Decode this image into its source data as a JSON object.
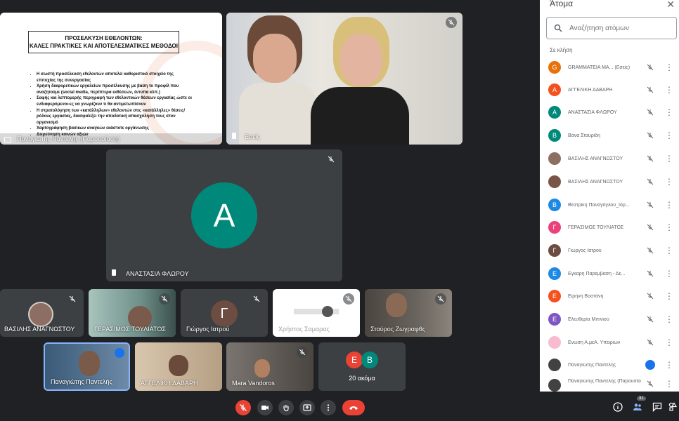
{
  "colors": {
    "teal": "#00897b",
    "red": "#ea4335",
    "brown": "#6d4c41"
  },
  "slide": {
    "title1": "ΠΡΟΣΕΛΚΥΣΗ ΕΘΕΛΟΝΤΩΝ:",
    "title2": "ΚΑΛΕΣ ΠΡΑΚΤΙΚΕΣ ΚΑΙ ΑΠΟΤΕΛΕΣΜΑΤΙΚΕΣ ΜΕΘΟΔΟΙ",
    "bullets": [
      "Η σωστή προσέλκυση εθελοντών αποτελεί καθοριστικό στοιχείο της επιτυχίας της συνεργασίας",
      "Χρήση διαφορετικών εργαλείων προσέλκυσης με βάση το προφίλ που αναζητούμε (social media, περίπτερα εκθέσεων, έντυπα κλπ.)",
      "Σαφής και λεπτομερής περιγραφή των εθελοντικών θέσεων εργασίας ώστε οι ενδιαφερόμενοι-ες να γνωρίζουν τι θα αντιμετωπίσουν",
      "Η στρατολόγηση των «κατάλληλων» εθελοντών στις «κατάλληλες» θέσεις/ρόλους εργασίας, διασφαλίζει την αποδοτική απασχόληση τους στον οργανισμό",
      "Χαρτογράφηση βασικών αναγκών εκάστοτε οργάνωσης",
      "Διερεύνηση κοινών αξιών"
    ],
    "presenter": "Παναγιώτης Παντελής (Παρουσίαση)"
  },
  "tiles": {
    "you": "Εσείς",
    "main_name": "ΑΝΑΣΤΑΣΙΑ ΦΛΩΡΟΥ",
    "main_initial": "Α",
    "row1": [
      {
        "name": "ΒΑΣΙΛΗΣ ΑΝΑΓΝΩΣΤΟΥ"
      },
      {
        "name": "ΓΕΡΑΣΙΜΟΣ ΤΟΥΛΙΑΤΟΣ"
      },
      {
        "name": "Γιώργος Ιατρού",
        "initial": "Γ"
      },
      {
        "name": "Χρήστος Σαμαρας"
      },
      {
        "name": "Σταύρος Ζωγραφθς"
      }
    ],
    "row2": [
      {
        "name": "Παναγιώτης Παντελής"
      },
      {
        "name": "ΑΓΓΕΛΙΚΗ ΔΑΒΑΡΗ"
      },
      {
        "name": "Mara Vandoros"
      }
    ],
    "more_a": "Ε",
    "more_b": "Β",
    "more_label": "20 ακόμα"
  },
  "panel": {
    "title": "Άτομα",
    "search_placeholder": "Αναζήτηση ατόμων",
    "section": "Σε κλήση",
    "people": [
      {
        "name": "GRAMMATEIA MA... (Εσείς)",
        "initial": "G",
        "color": "#e8710a"
      },
      {
        "name": "ΑΓΓΕΛΙΚΗ ΔΑΒΑΡΗ",
        "initial": "Α",
        "color": "#f4511e"
      },
      {
        "name": "ΑΝΑΣΤΑΣΙΑ ΦΛΩΡΟΥ",
        "initial": "Α",
        "color": "#00897b"
      },
      {
        "name": "Βάνα Σταυρίδη",
        "initial": "Β",
        "color": "#00897b"
      },
      {
        "name": "ΒΑΣΙΛΗΣ ΑΝΑΓΝΩΣΤΟΥ",
        "initial": "",
        "color": "#8d6e63"
      },
      {
        "name": "ΒΑΣΙΛΗΣ ΑΝΑΓΝΩΣΤΟΥ",
        "initial": "",
        "color": "#795548"
      },
      {
        "name": "Βεατρίκη Παναγόγλου_Ιδρ...",
        "initial": "Β",
        "color": "#1e88e5"
      },
      {
        "name": "ΓΕΡΑΣΙΜΟΣ ΤΟΥΛΙΑΤΟΣ",
        "initial": "Γ",
        "color": "#ec407a"
      },
      {
        "name": "Γιώργος Ιατρού",
        "initial": "Γ",
        "color": "#6d4c41"
      },
      {
        "name": "Εγκαρη Παρέμβαση - Δε...",
        "initial": "Ε",
        "color": "#1e88e5"
      },
      {
        "name": "Ειρήνη Βοστάνη",
        "initial": "Ε",
        "color": "#f4511e"
      },
      {
        "name": "Ελευθερία Μπινιού",
        "initial": "Ε",
        "color": "#7e57c2"
      },
      {
        "name": "Ενωση Α.μεΑ. Υπειρίων",
        "initial": "",
        "color": "#f8bbd0"
      },
      {
        "name": "Παναγιώτης Παντελής",
        "initial": "",
        "color": "#424242"
      },
      {
        "name": "Παναγιώτης Παντελής (Παρουσίαση)",
        "initial": "",
        "color": "#424242"
      }
    ]
  },
  "bottom": {
    "people_count": "31"
  }
}
